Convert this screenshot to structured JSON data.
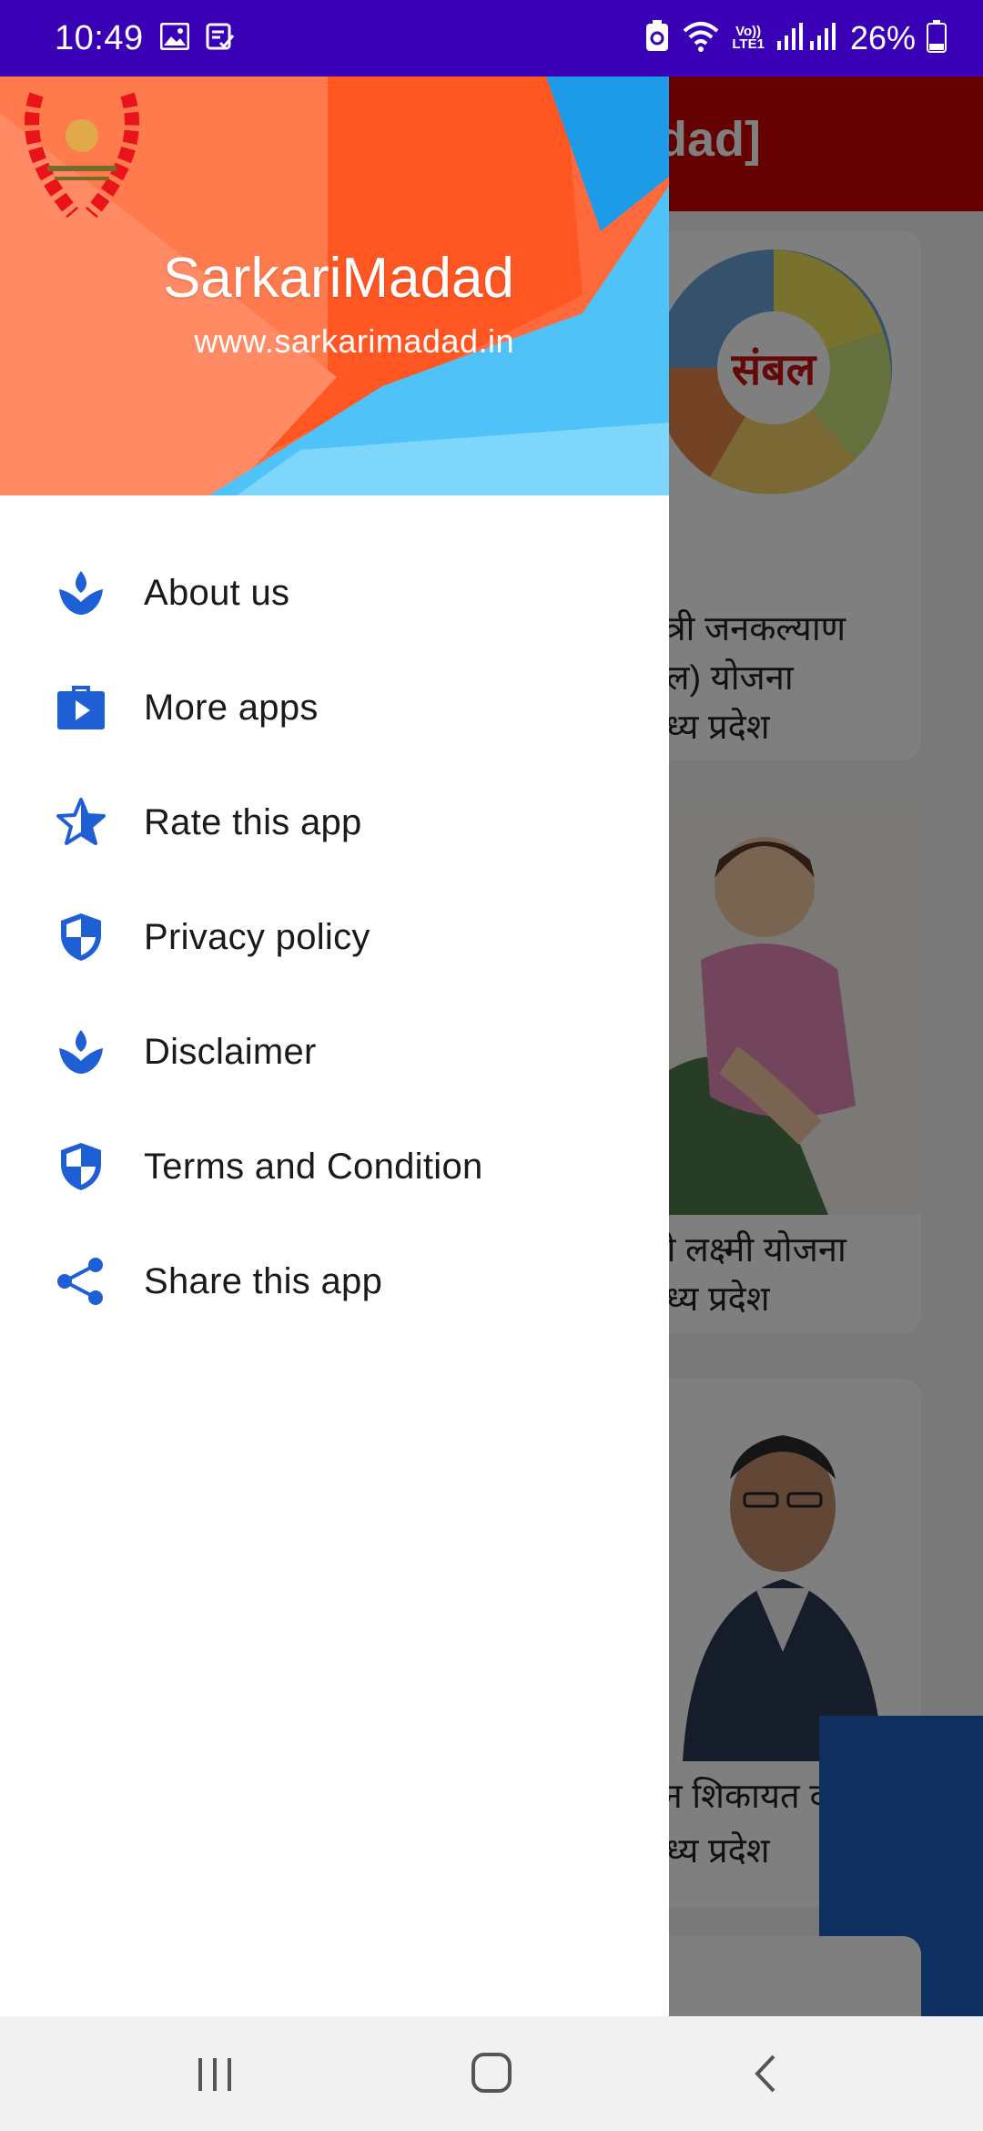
{
  "status_bar": {
    "time": "10:49",
    "network_label_top": "Vo))",
    "network_label_bottom": "LTE1",
    "battery": "26%",
    "icons": [
      "gallery-icon",
      "note-icon",
      "battery-saver-icon",
      "wifi-icon",
      "signal-icon",
      "battery-icon"
    ]
  },
  "background_app": {
    "title_fragment": "dad]",
    "cards": [
      {
        "line1": "ंत्री जनकल्याण",
        "line2": "बल) योजना",
        "line3": "नध्य प्रदेश",
        "image_text": "संबल"
      },
      {
        "line1": "ी लक्ष्मी योजना",
        "line2": "नध्य प्रदेश"
      },
      {
        "line1": "इन शिकायत दर्ज",
        "line2": "नध्य प्रदेश"
      }
    ]
  },
  "drawer": {
    "brand_name": "SarkariMadad",
    "brand_url": "www.sarkarimadad.in",
    "menu_items": [
      {
        "label": "About us",
        "icon": "lotus-icon"
      },
      {
        "label": "More apps",
        "icon": "play-bag-icon"
      },
      {
        "label": "Rate this app",
        "icon": "star-icon"
      },
      {
        "label": "Privacy policy",
        "icon": "shield-icon"
      },
      {
        "label": "Disclaimer",
        "icon": "lotus-icon"
      },
      {
        "label": "Terms and Condition",
        "icon": "shield-icon"
      },
      {
        "label": "Share this app",
        "icon": "share-icon"
      }
    ]
  },
  "colors": {
    "status_bar": "#3a00b6",
    "icon_blue": "#1f5fd6",
    "header_orange": "#ff5a1f",
    "header_blue": "#4fc3f7"
  },
  "nav_bar": {
    "buttons": [
      "recent-apps-icon",
      "home-icon",
      "back-icon"
    ]
  }
}
